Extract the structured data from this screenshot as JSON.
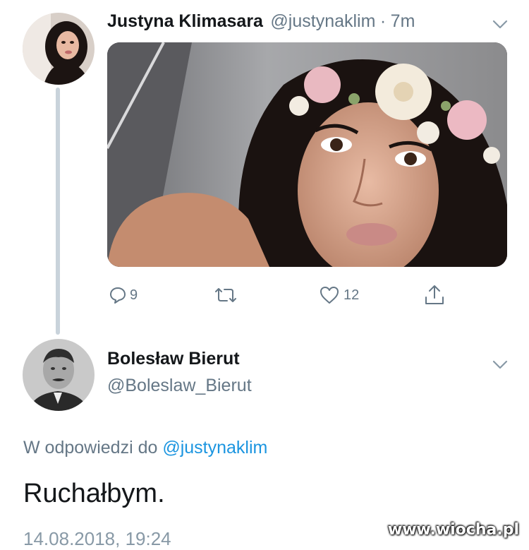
{
  "original_tweet": {
    "author_name": "Justyna Klimasara",
    "author_handle": "@justynaklim",
    "time_ago": "7m",
    "separator": "·",
    "reply_count": "9",
    "like_count": "12",
    "icons": [
      "menu-chevron-icon",
      "reply-icon",
      "retweet-icon",
      "like-icon",
      "share-icon"
    ]
  },
  "reply_tweet": {
    "author_name": "Bolesław Bierut",
    "author_handle": "@Boleslaw_Bierut",
    "replying_prefix": "W odpowiedzi do",
    "replying_mention": "@justynaklim",
    "text": "Ruchałbym.",
    "timestamp": "14.08.2018, 19:24"
  },
  "watermark": "www.wiocha.pl",
  "colors": {
    "text": "#14171a",
    "secondary": "#657786",
    "link": "#1b95e0",
    "thread_line": "#c9d3db"
  }
}
